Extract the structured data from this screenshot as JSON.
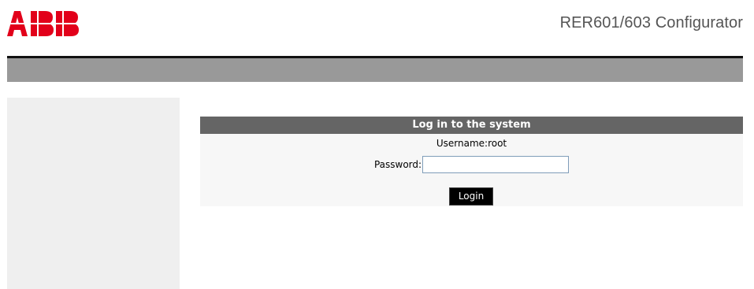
{
  "header": {
    "logo_text": "ABB",
    "app_title": "RER601/603 Configurator"
  },
  "colors": {
    "logo_red": "#e2001a",
    "topbar_gray": "#999999",
    "panel_header_gray": "#656565",
    "sidebar_bg": "#efefef",
    "button_bg": "#000000"
  },
  "login": {
    "title": "Log in to the system",
    "username_text": "Username:root",
    "password_label": "Password:",
    "password_value": "",
    "login_button": "Login"
  }
}
